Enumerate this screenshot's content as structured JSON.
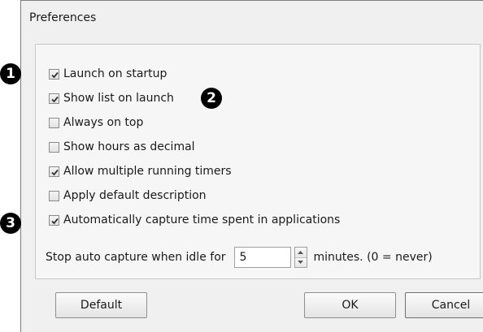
{
  "window": {
    "title": "Preferences"
  },
  "options": [
    {
      "label": "Launch on startup",
      "checked": true
    },
    {
      "label": "Show list on launch",
      "checked": true
    },
    {
      "label": "Always on top",
      "checked": false
    },
    {
      "label": "Show hours as decimal",
      "checked": false
    },
    {
      "label": "Allow multiple running timers",
      "checked": true
    },
    {
      "label": "Apply default description",
      "checked": false
    },
    {
      "label": "Automatically capture time spent in applications",
      "checked": true
    }
  ],
  "idle": {
    "label": "Stop auto capture when idle for",
    "value": "5",
    "suffix": "minutes. (0 = never)"
  },
  "buttons": {
    "default": "Default",
    "ok": "OK",
    "cancel": "Cancel"
  },
  "markers": {
    "one": "1",
    "two": "2",
    "three": "3"
  },
  "colors": {
    "window_bg": "#f0f0f0",
    "panel_bg": "#f6f6f6",
    "marker_bg": "#000000",
    "checkmark": "#333333"
  }
}
